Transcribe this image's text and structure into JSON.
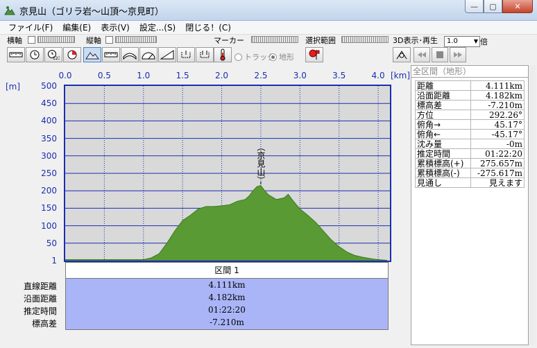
{
  "window": {
    "title": "京見山（ゴリラ岩～山頂～京見町）",
    "min_glyph": "—",
    "max_glyph": "▢",
    "close_glyph": "✕"
  },
  "menu": [
    "ファイル(F)",
    "編集(E)",
    "表示(V)",
    "設定...(S)",
    "閉じる！(C)"
  ],
  "toolbar": {
    "horizontal_axis_label": "横軸",
    "vertical_axis_label": "縦軸",
    "marker_label": "マーカー",
    "selection_label": "選択範囲",
    "display_3d_label": "3D表示･再生",
    "speed_value": "1.0",
    "speed_unit": "倍",
    "radio_track": "トラック",
    "radio_terrain": "地形"
  },
  "axes": {
    "x_unit": "[km]",
    "y_unit": "[m]",
    "x_ticks": [
      "0.0",
      "0.5",
      "1.0",
      "1.5",
      "2.0",
      "2.5",
      "3.0",
      "3.5",
      "4.0"
    ],
    "y_ticks": [
      "500",
      "450",
      "400",
      "350",
      "300",
      "250",
      "200",
      "150",
      "100",
      "50",
      "1"
    ]
  },
  "chart_data": {
    "type": "area",
    "xlabel": "[km]",
    "ylabel": "[m]",
    "xlim": [
      0,
      4.111
    ],
    "ylim": [
      0,
      500
    ],
    "x": [
      0.0,
      0.5,
      0.8,
      1.0,
      1.1,
      1.2,
      1.3,
      1.4,
      1.5,
      1.6,
      1.7,
      1.8,
      1.9,
      2.0,
      2.1,
      2.2,
      2.3,
      2.35,
      2.4,
      2.45,
      2.5,
      2.55,
      2.6,
      2.7,
      2.8,
      2.85,
      2.9,
      3.0,
      3.1,
      3.2,
      3.3,
      3.4,
      3.5,
      3.6,
      3.7,
      3.8,
      3.9,
      4.0,
      4.111
    ],
    "y": [
      3,
      3,
      3,
      3,
      8,
      20,
      50,
      85,
      115,
      130,
      148,
      155,
      155,
      157,
      160,
      170,
      175,
      185,
      200,
      212,
      215,
      200,
      188,
      175,
      180,
      190,
      175,
      148,
      130,
      110,
      85,
      60,
      40,
      25,
      15,
      10,
      6,
      3,
      1
    ],
    "annotation": "（京見山）",
    "annotation_x": 2.5
  },
  "section": {
    "header": "区間 1",
    "labels": [
      "直線距離",
      "沿面距離",
      "推定時間",
      "標高差"
    ],
    "values": [
      "4.111km",
      "4.182km",
      "01:22:20",
      "-7.210m"
    ]
  },
  "right_panel": {
    "title": "全区間（地形）",
    "rows": [
      {
        "label": "距離",
        "value": "4.111km"
      },
      {
        "label": "沿面距離",
        "value": "4.182km"
      },
      {
        "label": "標高差",
        "value": "-7.210m"
      },
      {
        "label": "方位",
        "value": "292.26°"
      },
      {
        "label": "俯角→",
        "value": "45.17°"
      },
      {
        "label": "俯角←",
        "value": "-45.17°"
      },
      {
        "label": "沈み量",
        "value": "-0m"
      },
      {
        "label": "推定時間",
        "value": "01:22:20"
      },
      {
        "label": "累積標高(+)",
        "value": "275.657m"
      },
      {
        "label": "累積標高(-)",
        "value": "-275.617m"
      },
      {
        "label": "見通し",
        "value": "見えます"
      }
    ]
  },
  "colors": {
    "axis_blue": "#1a2eb0",
    "terrain_green": "#5a9a34",
    "section_blue": "#aab5f7"
  }
}
